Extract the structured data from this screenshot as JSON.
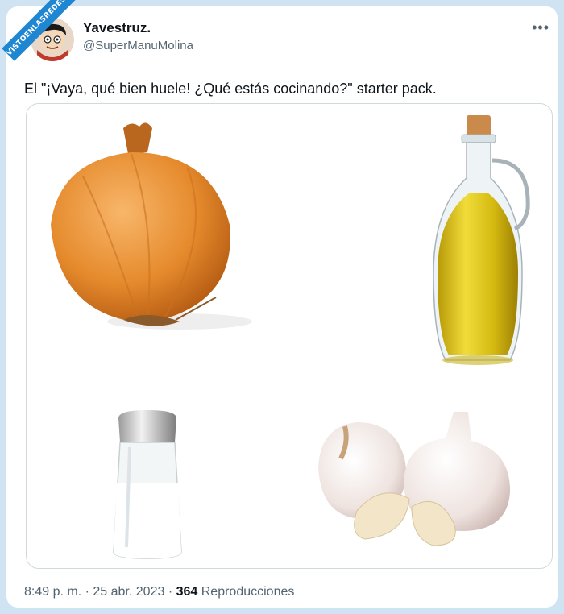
{
  "watermark": "VISTOENLASREDES.com",
  "tweet": {
    "display_name": "Yavestruz.",
    "handle": "@SuperManuMolina",
    "more_icon": "more-horizontal-icon",
    "text": "El \"¡Vaya, qué bien huele! ¿Qué estás cocinando?\" starter pack.",
    "time": "8:49 p. m.",
    "separator": "·",
    "date": "25 abr. 2023",
    "views_count": "364",
    "views_label": "Reproducciones"
  },
  "media": {
    "items": [
      "onion",
      "olive-oil-bottle",
      "salt-shaker",
      "garlic"
    ]
  },
  "colors": {
    "background": "#cfe3f3",
    "card": "#ffffff",
    "text": "#0f1419",
    "secondary": "#536471",
    "watermark": "#1f86d1"
  }
}
